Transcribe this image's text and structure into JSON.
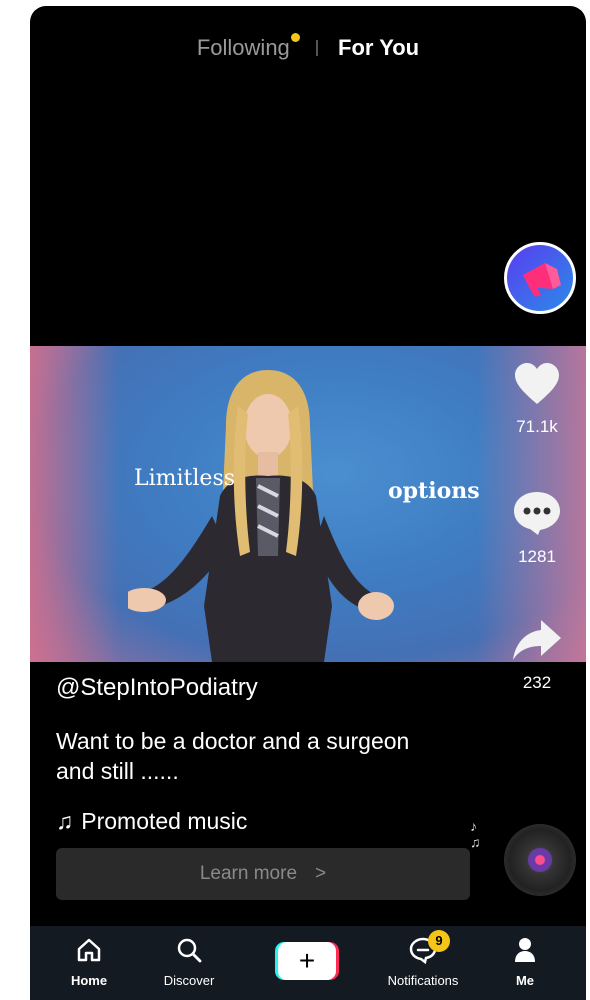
{
  "header": {
    "tabs": [
      {
        "label": "Following",
        "has_dot": true
      },
      {
        "label": "For You",
        "active": true
      }
    ]
  },
  "video": {
    "overlay_left": "Limitless",
    "overlay_right": "options"
  },
  "actions": {
    "likes": "71.1k",
    "comments": "1281",
    "shares": "232"
  },
  "post": {
    "username": "@StepIntoPodiatry",
    "caption": "Want to be a doctor and a surgeon and still ......",
    "music": "Promoted music",
    "music_icon": "music-note-icon"
  },
  "cta": {
    "label": "Learn more",
    "chevron": ">"
  },
  "nav": {
    "items": [
      {
        "label": "Home",
        "icon": "home-icon"
      },
      {
        "label": "Discover",
        "icon": "search-icon"
      },
      {
        "label": "+",
        "icon": "add-icon"
      },
      {
        "label": "Notifications",
        "icon": "chat-icon",
        "badge": "9"
      },
      {
        "label": "Me",
        "icon": "profile-icon"
      }
    ]
  },
  "colors": {
    "accent_dot": "#f5c518",
    "nav_bg": "#141a22",
    "cta_bg": "#2a2a2a"
  }
}
